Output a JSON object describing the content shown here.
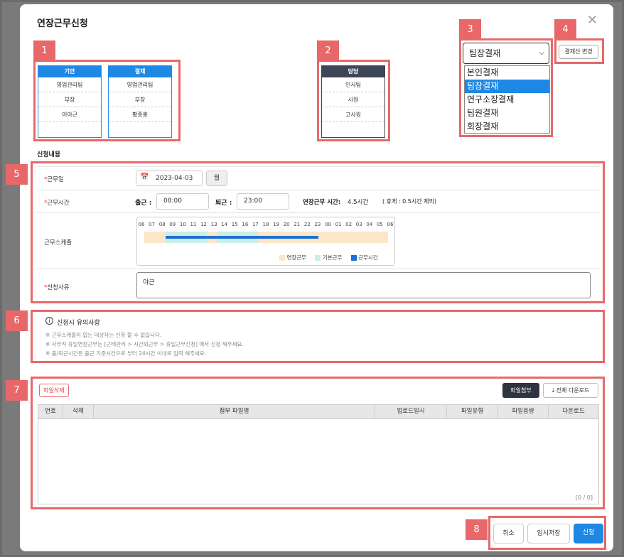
{
  "modal": {
    "title": "연장근무신청",
    "close": "✕"
  },
  "badges": [
    "1",
    "2",
    "3",
    "4",
    "5",
    "6",
    "7",
    "8"
  ],
  "approval": {
    "draft": {
      "header": "기안",
      "cells": [
        "영업관리팀",
        "부장",
        "이아근",
        ""
      ]
    },
    "approve": {
      "header": "결재",
      "cells": [
        "영업관리팀",
        "부장",
        "황종홍",
        ""
      ]
    },
    "charge": {
      "header": "담당",
      "cells": [
        "인사팀",
        "사원",
        "고사원",
        ""
      ]
    }
  },
  "approval_select": {
    "value": "팀장결재",
    "options": [
      "본인결재",
      "팀장결재",
      "연구소장결재",
      "팀원결재",
      "회장결재"
    ],
    "selected_index": 1
  },
  "change_line_button": "결재선 변경",
  "section_label": "신청내용",
  "form": {
    "workday": {
      "label": "근무일",
      "value": "2023-04-03",
      "day": "월"
    },
    "worktime": {
      "label": "근무시간",
      "in_label": "출근 :",
      "in_value": "08:00",
      "out_label": "퇴근 :",
      "out_value": "23:00",
      "ot_label": "연장근무 시간:",
      "ot_value": "4.5시간",
      "break_note": "( 휴게 : 0.5시간 제외)"
    },
    "schedule": {
      "label": "근무스케줄",
      "hours": [
        "06",
        "07",
        "08",
        "09",
        "10",
        "11",
        "12",
        "13",
        "14",
        "15",
        "16",
        "17",
        "18",
        "19",
        "20",
        "21",
        "22",
        "23",
        "00",
        "01",
        "02",
        "03",
        "04",
        "05",
        "06"
      ],
      "legend": [
        "연장근무",
        "기본근무",
        "근무시간"
      ],
      "colors": {
        "overtime": "#fde6c8",
        "basic": "#c8efe9",
        "worktime": "#1e6fcf"
      }
    },
    "reason": {
      "label": "신청사유",
      "value": "야근"
    }
  },
  "notice": {
    "title": "신청시 유의사항",
    "lines": [
      "※ 근무스케줄이 없는 대상자는 신청 할 수 없습니다.",
      "※ 사무직 휴일연장근무는 [근태관리 > 시간외근무 > 휴일근무신청] 에서 신청 해주세요.",
      "※ 출/퇴근시간은 출근 기준시간으로 부터 24시간 이내로 입력 해주세요."
    ]
  },
  "files": {
    "delete_button": "파일삭제",
    "attach_button": "파일첨부",
    "download_all_button": "전체 다운로드",
    "columns": [
      "번호",
      "삭제",
      "첨부 파일명",
      "업로드일시",
      "파일유형",
      "파일용량",
      "다운로드"
    ],
    "count": "[0 / 0]"
  },
  "footer": {
    "cancel": "취소",
    "temp_save": "임시저장",
    "submit": "신청"
  }
}
